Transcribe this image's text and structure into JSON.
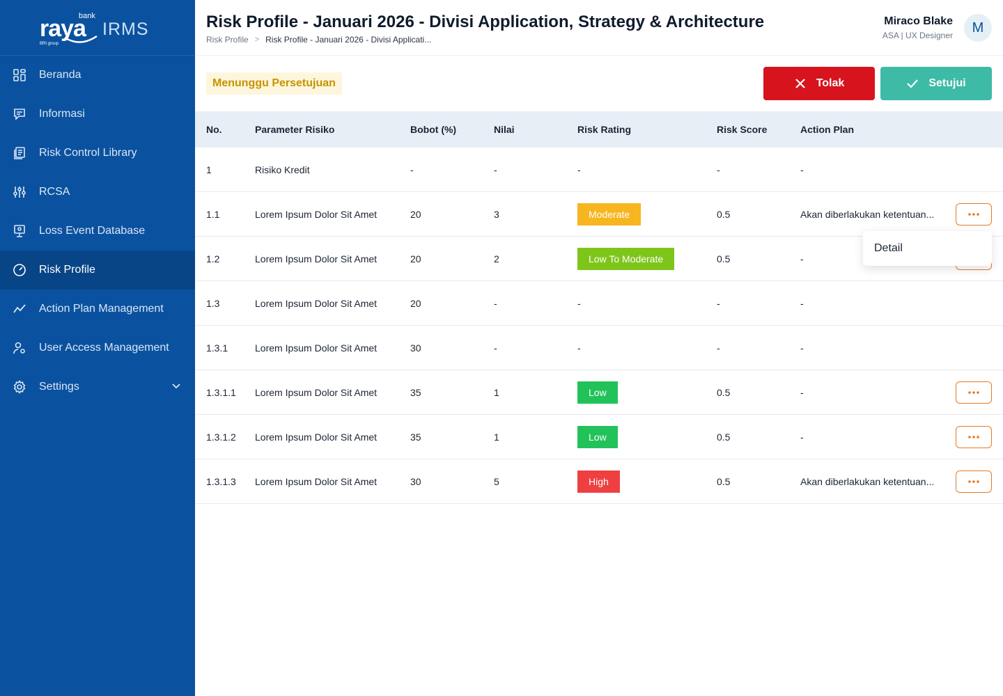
{
  "brand": {
    "name": "raya",
    "prefix": "bank",
    "product": "IRMS",
    "tagline": "BRI group"
  },
  "sidebar": {
    "items": [
      {
        "label": "Beranda",
        "icon": "grid-icon"
      },
      {
        "label": "Informasi",
        "icon": "message-icon"
      },
      {
        "label": "Risk Control Library",
        "icon": "library-icon"
      },
      {
        "label": "RCSA",
        "icon": "sliders-icon"
      },
      {
        "label": "Loss Event Database",
        "icon": "monitor-icon"
      },
      {
        "label": "Risk Profile",
        "icon": "gauge-icon",
        "active": true
      },
      {
        "label": "Action Plan Management",
        "icon": "trend-icon"
      },
      {
        "label": "User Access Management",
        "icon": "user-gear-icon"
      },
      {
        "label": "Settings",
        "icon": "gear-icon",
        "expandable": true
      }
    ]
  },
  "header": {
    "title": "Risk Profile - Januari 2026 - Divisi Application, Strategy & Architecture",
    "breadcrumb": {
      "root": "Risk Profile",
      "separator": ">",
      "current": "Risk Profile - Januari 2026 - Divisi Applicati..."
    },
    "user": {
      "name": "Miraco Blake",
      "role": "ASA | UX Designer",
      "initial": "M"
    }
  },
  "toolbar": {
    "status": "Menunggu Persetujuan",
    "reject_label": "Tolak",
    "approve_label": "Setujui"
  },
  "table": {
    "columns": [
      "No.",
      "Parameter Risiko",
      "Bobot (%)",
      "Nilai",
      "Risk Rating",
      "Risk Score",
      "Action Plan"
    ],
    "rows": [
      {
        "no": "1",
        "param": "Risiko Kredit",
        "bobot": "-",
        "nilai": "-",
        "rating": "-",
        "score": "-",
        "plan": "-",
        "menu": false
      },
      {
        "no": "1.1",
        "param": "Lorem Ipsum Dolor Sit Amet",
        "bobot": "20",
        "nilai": "3",
        "rating": "Moderate",
        "rating_color": "#f7b51f",
        "score": "0.5",
        "plan": "Akan diberlakukan ketentuan...",
        "menu": true
      },
      {
        "no": "1.2",
        "param": "Lorem Ipsum Dolor Sit Amet",
        "bobot": "20",
        "nilai": "2",
        "rating": "Low To Moderate",
        "rating_color": "#7ec51a",
        "score": "0.5",
        "plan": "-",
        "menu": true
      },
      {
        "no": "1.3",
        "param": "Lorem Ipsum Dolor Sit Amet",
        "bobot": "20",
        "nilai": "-",
        "rating": "-",
        "score": "-",
        "plan": "-",
        "menu": false
      },
      {
        "no": "1.3.1",
        "param": "Lorem Ipsum Dolor Sit Amet",
        "bobot": "30",
        "nilai": "-",
        "rating": "-",
        "score": "-",
        "plan": "-",
        "menu": false
      },
      {
        "no": "1.3.1.1",
        "param": "Lorem Ipsum Dolor Sit Amet",
        "bobot": "35",
        "nilai": "1",
        "rating": "Low",
        "rating_color": "#22c25a",
        "score": "0.5",
        "plan": "-",
        "menu": true
      },
      {
        "no": "1.3.1.2",
        "param": "Lorem Ipsum Dolor Sit Amet",
        "bobot": "35",
        "nilai": "1",
        "rating": "Low",
        "rating_color": "#22c25a",
        "score": "0.5",
        "plan": "-",
        "menu": true
      },
      {
        "no": "1.3.1.3",
        "param": "Lorem Ipsum Dolor Sit Amet",
        "bobot": "30",
        "nilai": "5",
        "rating": "High",
        "rating_color": "#ee4040",
        "score": "0.5",
        "plan": "Akan diberlakukan ketentuan...",
        "menu": true
      }
    ]
  },
  "dropdown": {
    "open_for_row": "1.1",
    "items": [
      "Detail"
    ]
  },
  "colors": {
    "sidebar": "#0a52a0",
    "sidebar_active": "#084587",
    "reject": "#d7141e",
    "approve": "#3dbba7",
    "status_text": "#c79300",
    "menu_border": "#e67a22"
  }
}
